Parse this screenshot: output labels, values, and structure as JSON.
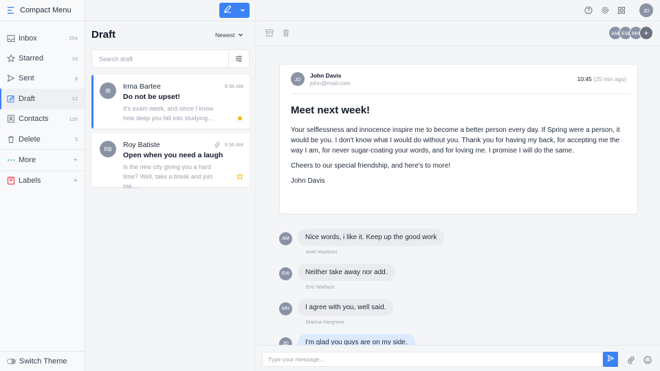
{
  "sidebar": {
    "brand": "Compact Menu",
    "items": [
      {
        "label": "Inbox",
        "count": "254",
        "icon": "inbox-icon"
      },
      {
        "label": "Starred",
        "count": "16",
        "icon": "star-icon"
      },
      {
        "label": "Sent",
        "count": "8",
        "icon": "send-icon"
      },
      {
        "label": "Draft",
        "count": "12",
        "icon": "draft-icon",
        "active": true
      },
      {
        "label": "Contacts",
        "count": "128",
        "icon": "contacts-icon"
      },
      {
        "label": "Delete",
        "count": "3",
        "icon": "trash-icon"
      },
      {
        "label": "More",
        "count": "+",
        "icon": "more-icon"
      },
      {
        "label": "Labels",
        "count": "+",
        "icon": "bookmark-icon"
      }
    ],
    "switch_theme": "Switch Theme"
  },
  "list": {
    "title": "Draft",
    "sort": "Newest",
    "search_placeholder": "Search draft",
    "messages": [
      {
        "initials": "IB",
        "name": "Irma Bartee",
        "time": "9:36 AM",
        "subject": "Do not be upset!",
        "preview": "It's exam week, and since I know how deep you fall into studying…",
        "starred": true
      },
      {
        "initials": "RB",
        "name": "Roy Batiste",
        "time": "9:36 AM",
        "subject": "Open when you need a laugh",
        "preview": "Is the new city giving you a hard time? Well, take a break and join me…",
        "starred": false,
        "attachment": true
      }
    ]
  },
  "header": {
    "user_initials": "JD",
    "participants": [
      "AM",
      "EW",
      "MH",
      "+"
    ]
  },
  "email": {
    "from_initials": "JD",
    "from_name": "John Davis",
    "from_email": "john@mail.com",
    "time": "10:45",
    "ago": "(25 min ago)",
    "subject": "Meet next week!",
    "paragraphs": [
      "Your selflessness and innocence inspire me to become a better person every day. If Spring were a person, it would be you. I don't know what I would do without you. Thank you for having my back, for accepting me the way I am, for never sugar-coating your words, and for loving me. I promise I will do the same.",
      "Cheers to our special friendship, and here's to more!",
      "John Davis"
    ]
  },
  "chat": [
    {
      "initials": "AM",
      "text": "Nice words, i like it. Keep up the good work",
      "sender": "Ariel Martinez"
    },
    {
      "initials": "EW",
      "text": "Neither take away nor add.",
      "sender": "Eric Wallace"
    },
    {
      "initials": "MH",
      "text": "I agree with you, well said.",
      "sender": "Marina Hargrove"
    },
    {
      "initials": "JD",
      "text": "I'm glad you guys are on my side.",
      "sender": ""
    }
  ],
  "composer": {
    "placeholder": "Type your message..."
  },
  "colors": {
    "accent": "#3b82f6",
    "star": "#f5b301",
    "avatar": "#8a93a6"
  }
}
